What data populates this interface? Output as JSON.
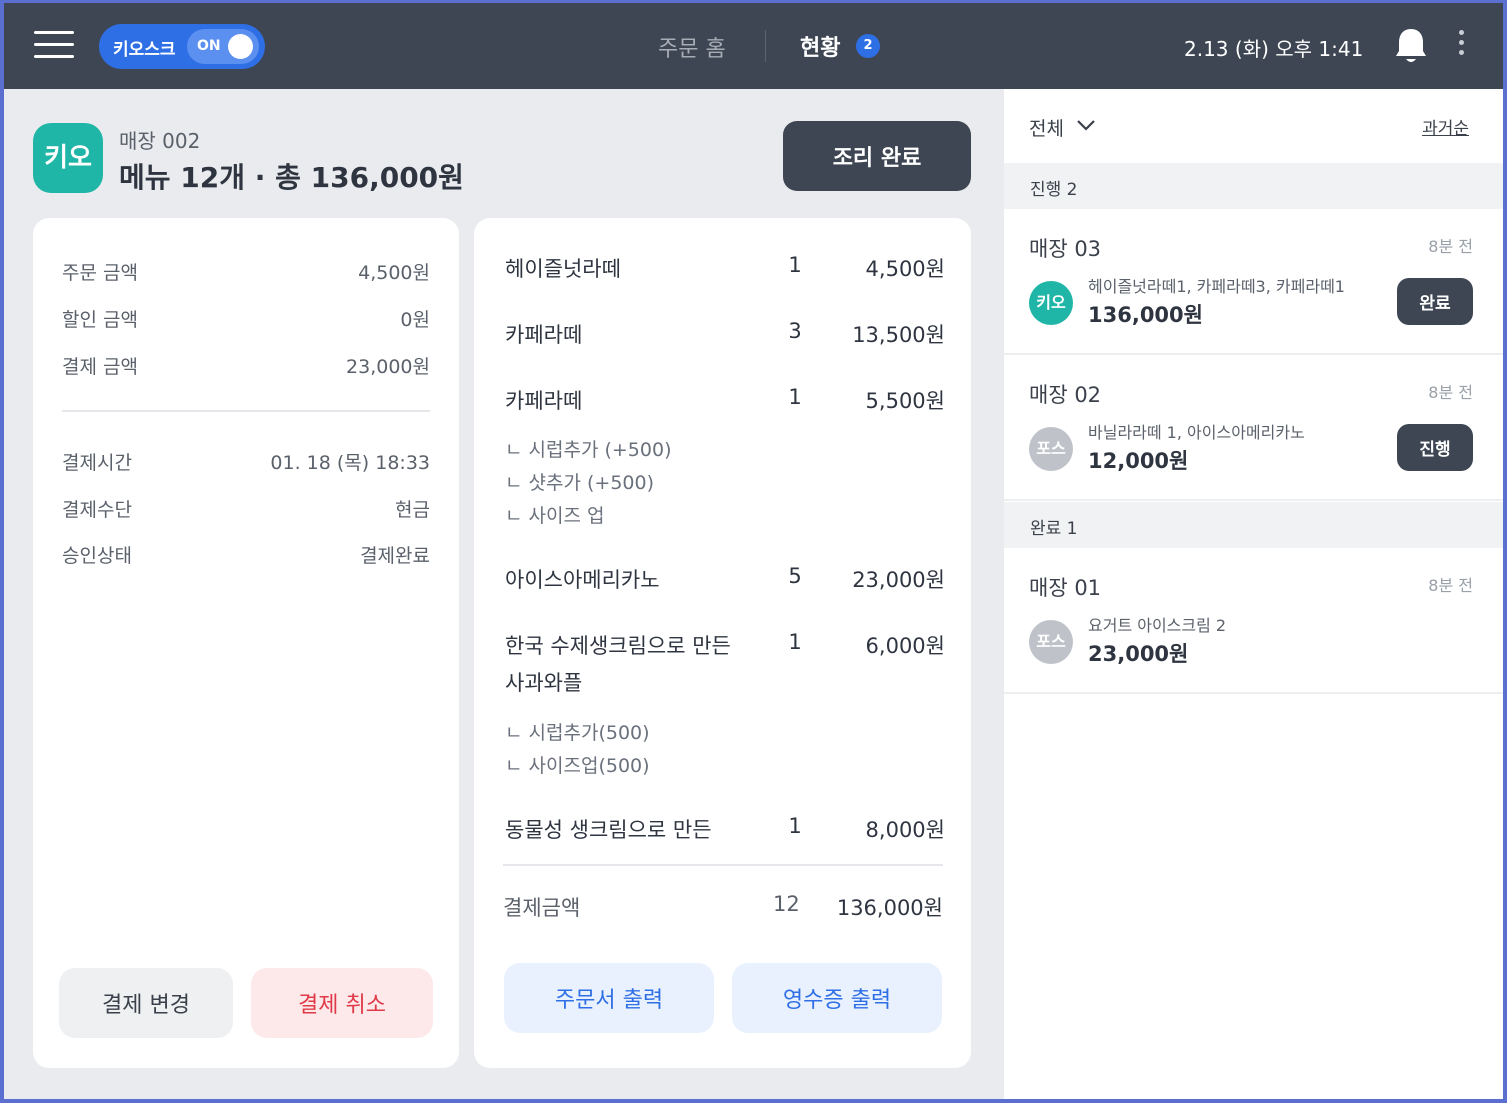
{
  "topbar": {
    "kiosk_label": "키오스크",
    "kiosk_toggle": "ON",
    "nav_home": "주문 홈",
    "nav_status": "현황",
    "nav_status_badge": "2",
    "datetime": "2.13 (화) 오후 1:41",
    "icons": [
      "hamburger-menu-icon",
      "bell-icon",
      "more-vertical-icon"
    ]
  },
  "order": {
    "channel_badge": "키오",
    "store": "매장 002",
    "summary": "메뉴 12개 · 총 136,000원",
    "cook_done_label": "조리 완료"
  },
  "payment": {
    "rows": [
      {
        "k": "주문 금액",
        "v": "4,500원"
      },
      {
        "k": "할인 금액",
        "v": "0원"
      },
      {
        "k": "결제 금액",
        "v": "23,000원"
      },
      {
        "k": "결제시간",
        "v": "01. 18 (목) 18:33"
      },
      {
        "k": "결제수단",
        "v": "현금"
      },
      {
        "k": "승인상태",
        "v": "결제완료"
      }
    ],
    "change_label": "결제 변경",
    "cancel_label": "결제 취소"
  },
  "items": {
    "list": [
      {
        "name": "헤이즐넛라떼",
        "qty": "1",
        "price": "4,500원"
      },
      {
        "name": "카페라떼",
        "qty": "3",
        "price": "13,500원"
      },
      {
        "name": "카페라떼",
        "qty": "1",
        "price": "5,500원"
      },
      {
        "name": "아이스아메리카노",
        "qty": "5",
        "price": "23,000원"
      },
      {
        "name": "한국 수제생크림으로 만든",
        "name2": "사과와플",
        "qty": "1",
        "price": "6,000원"
      },
      {
        "name": "동물성 생크림으로 만든",
        "qty": "1",
        "price": "8,000원"
      }
    ],
    "options_latte": [
      "ㄴ 시럽추가 (+500)",
      "ㄴ 샷추가 (+500)",
      "ㄴ 사이즈 업"
    ],
    "options_waffle": [
      "ㄴ 시럽추가(500)",
      "ㄴ 사이즈업(500)"
    ],
    "total_label": "결제금액",
    "total_qty": "12",
    "total_price": "136,000원",
    "print_order_label": "주문서 출력",
    "print_receipt_label": "영수증 출력"
  },
  "sidebar": {
    "filter": "전체",
    "sort": "과거순",
    "in_progress_header": "진행 2",
    "done_header": "완료 1",
    "orders": [
      {
        "store": "매장 03",
        "time": "8분 전",
        "badge": "키오",
        "badge_color": "#20b6a7",
        "items": "헤이즐넛라떼1, 카페라떼3, 카페라떼1",
        "amount": "136,000원",
        "button": "완료"
      },
      {
        "store": "매장 02",
        "time": "8분 전",
        "badge": "포스",
        "badge_color": "#bfc3c9",
        "items": "바닐라라떼 1, 아이스아메리카노",
        "amount": "12,000원",
        "button": "진행"
      },
      {
        "store": "매장 01",
        "time": "8분 전",
        "badge": "포스",
        "badge_color": "#bfc3c9",
        "items": "요거트 아이스크림 2",
        "amount": "23,000원"
      }
    ]
  },
  "colors": {
    "topbar": "#3d4652",
    "accent_blue": "#2f6fe6",
    "kiosk_teal": "#20b6a7",
    "cancel_red": "#e03a48"
  }
}
